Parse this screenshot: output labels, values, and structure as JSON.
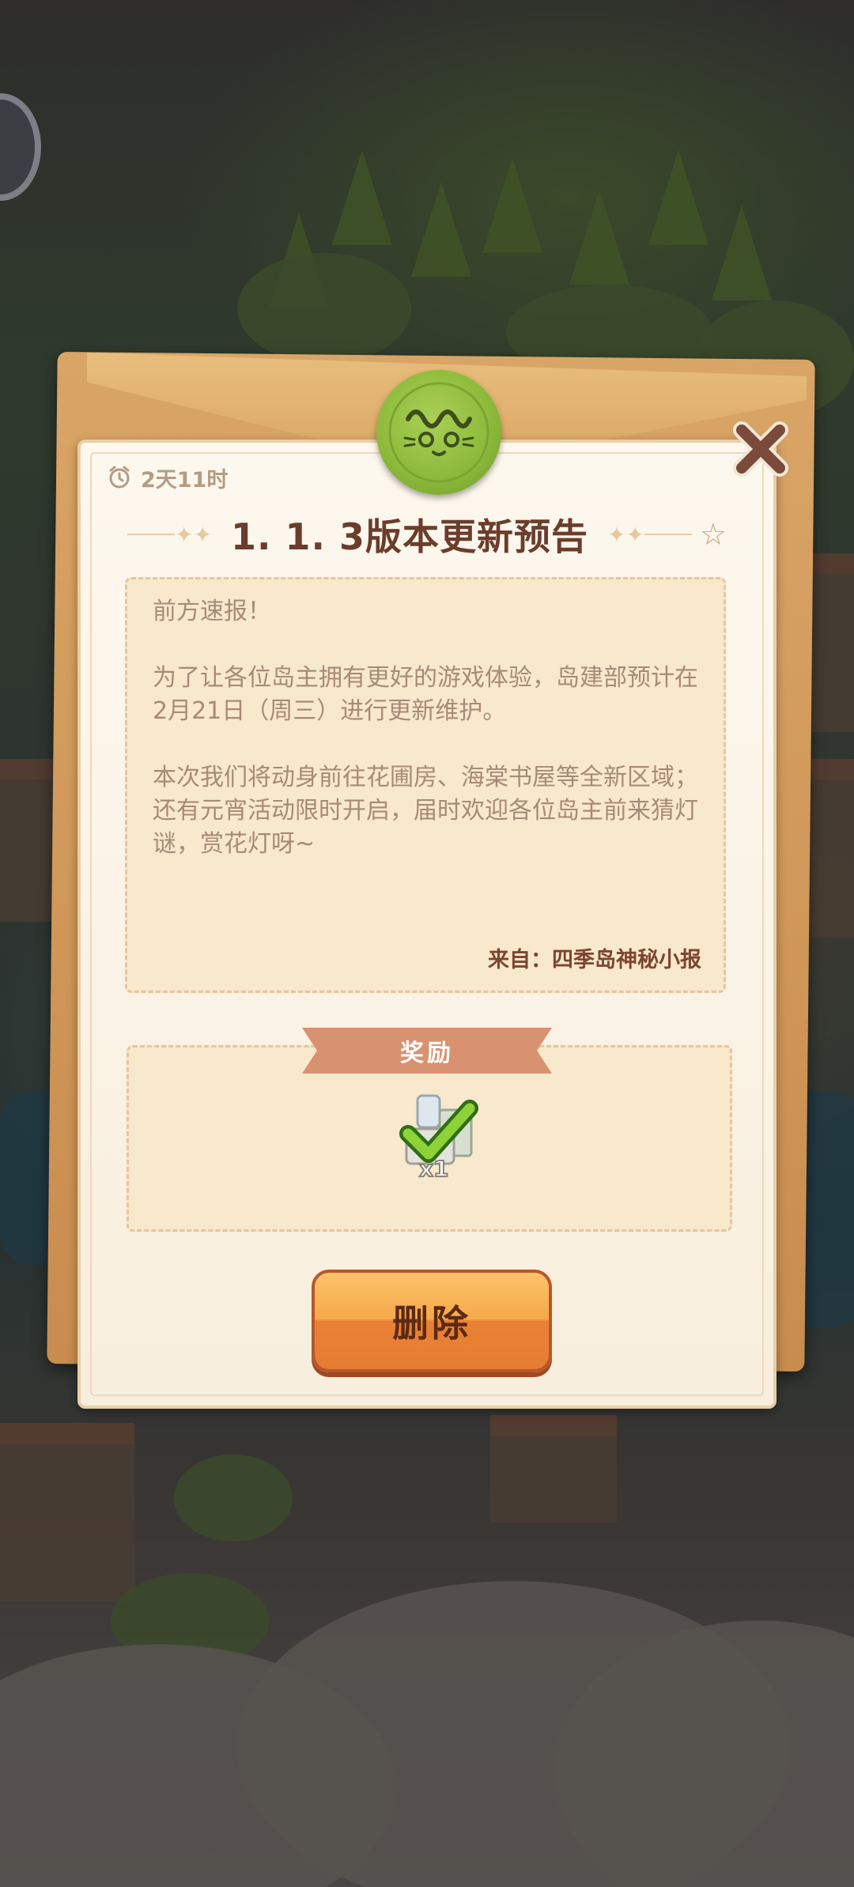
{
  "dialog": {
    "timer": "2天11时",
    "title": "1. 1. 3版本更新预告",
    "letter": {
      "greeting": "前方速报！",
      "paragraph1": "为了让各位岛主拥有更好的游戏体验，岛建部预计在2月21日（周三）进行更新维护。",
      "paragraph2": "本次我们将动身前往花圃房、海棠书屋等全新区域；还有元宵活动限时开启，届时欢迎各位岛主前来猜灯谜，赏花灯呀~",
      "from": "来自：四季岛神秘小报"
    },
    "reward": {
      "label": "奖励",
      "quantity": "x1",
      "icon": "checkmark-item-icon"
    },
    "delete_label": "删除"
  },
  "icons": {
    "timer": "alarm-clock-icon",
    "close": "close-icon",
    "seal": "wax-seal-icon",
    "star": "star-icon"
  },
  "colors": {
    "title": "#6b3d2c",
    "seal": "#8ebb3c",
    "button": "#f6a84a",
    "ribbon": "#d99270"
  }
}
